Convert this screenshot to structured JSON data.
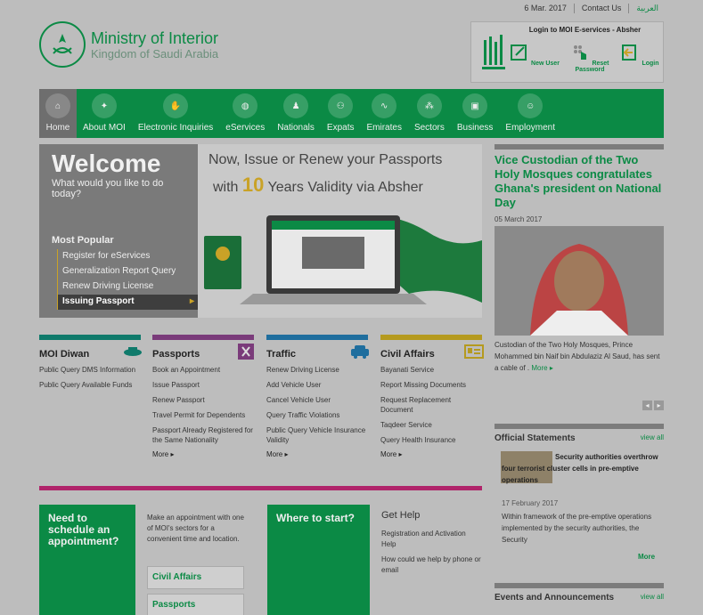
{
  "topbar": {
    "date": "6 Mar. 2017",
    "contact": "Contact Us",
    "arabic": "العربية"
  },
  "logo": {
    "title": "Ministry of Interior",
    "subtitle": "Kingdom of Saudi Arabia"
  },
  "login": {
    "title": "Login to MOI E-services - Absher",
    "new_user": "New User",
    "reset": "Reset Password",
    "login": "Login"
  },
  "nav": [
    "Home",
    "About MOI",
    "Electronic Inquiries",
    "eServices",
    "Nationals",
    "Expats",
    "Emirates",
    "Sectors",
    "Business",
    "Employment"
  ],
  "banner": {
    "welcome": "Welcome",
    "question": "What would you like to do today?",
    "line1": "Now, Issue or Renew your Passports",
    "line2a": "with",
    "line2b": "10",
    "line2c": "Years Validity via Absher",
    "most_popular": "Most Popular",
    "popular_items": [
      "Register for eServices",
      "Generalization Report Query",
      "Renew Driving License",
      "Issuing Passport"
    ]
  },
  "news": {
    "title": "Vice Custodian of the Two Holy Mosques congratulates Ghana's president on National Day",
    "date": "05 March 2017",
    "caption": "Custodian of the Two Holy Mosques, Prince Mohammed bin Naif bin Abdulaziz Al Saud, has sent a cable of .",
    "more": "More"
  },
  "columns": [
    {
      "title": "MOI Diwan",
      "color": "#0f7a6b",
      "items": [
        "Public Query DMS Information",
        "Public Query Available Funds"
      ],
      "more": ""
    },
    {
      "title": "Passports",
      "color": "#7a3b7a",
      "items": [
        "Book an Appointment",
        "Issue Passport",
        "Renew Passport",
        "Travel Permit for Dependents",
        "Passport Already Registered for the Same Nationality"
      ],
      "more": "More"
    },
    {
      "title": "Traffic",
      "color": "#1f6e9e",
      "items": [
        "Renew Driving License",
        "Add Vehicle User",
        "Cancel Vehicle User",
        "Query Traffic Violations",
        "Public Query Vehicle Insurance Validity"
      ],
      "more": "More"
    },
    {
      "title": "Civil Affairs",
      "color": "#b59a1f",
      "items": [
        "Bayanati Service",
        "Report Missing Documents",
        "Request Replacement Document",
        "Taqdeer Service",
        "Query Health Insurance"
      ],
      "more": "More"
    }
  ],
  "appointment": {
    "heading": "Need to schedule an appointment?",
    "text": "Make an appointment with one of MOI's sectors for a convenient time and location.",
    "options": [
      "Civil Affairs",
      "Passports"
    ]
  },
  "where": {
    "heading": "Where to start?"
  },
  "help": {
    "heading": "Get Help",
    "items": [
      "Registration and Activation Help",
      "How could we help by phone or email"
    ]
  },
  "statements": {
    "heading": "Official Statements",
    "view_all": "view all",
    "title": "Security authorities overthrow four terrorist cluster cells in pre-emptive operations",
    "date": "17 February 2017",
    "text": "Within framework of the pre-emptive operations implemented by the security authorities, the Security",
    "more": "More"
  },
  "events": {
    "heading": "Events and Announcements",
    "view_all": "view all"
  },
  "colors": {
    "brand": "#0b8a45",
    "gold": "#c9a227",
    "pink": "#b0246a"
  }
}
